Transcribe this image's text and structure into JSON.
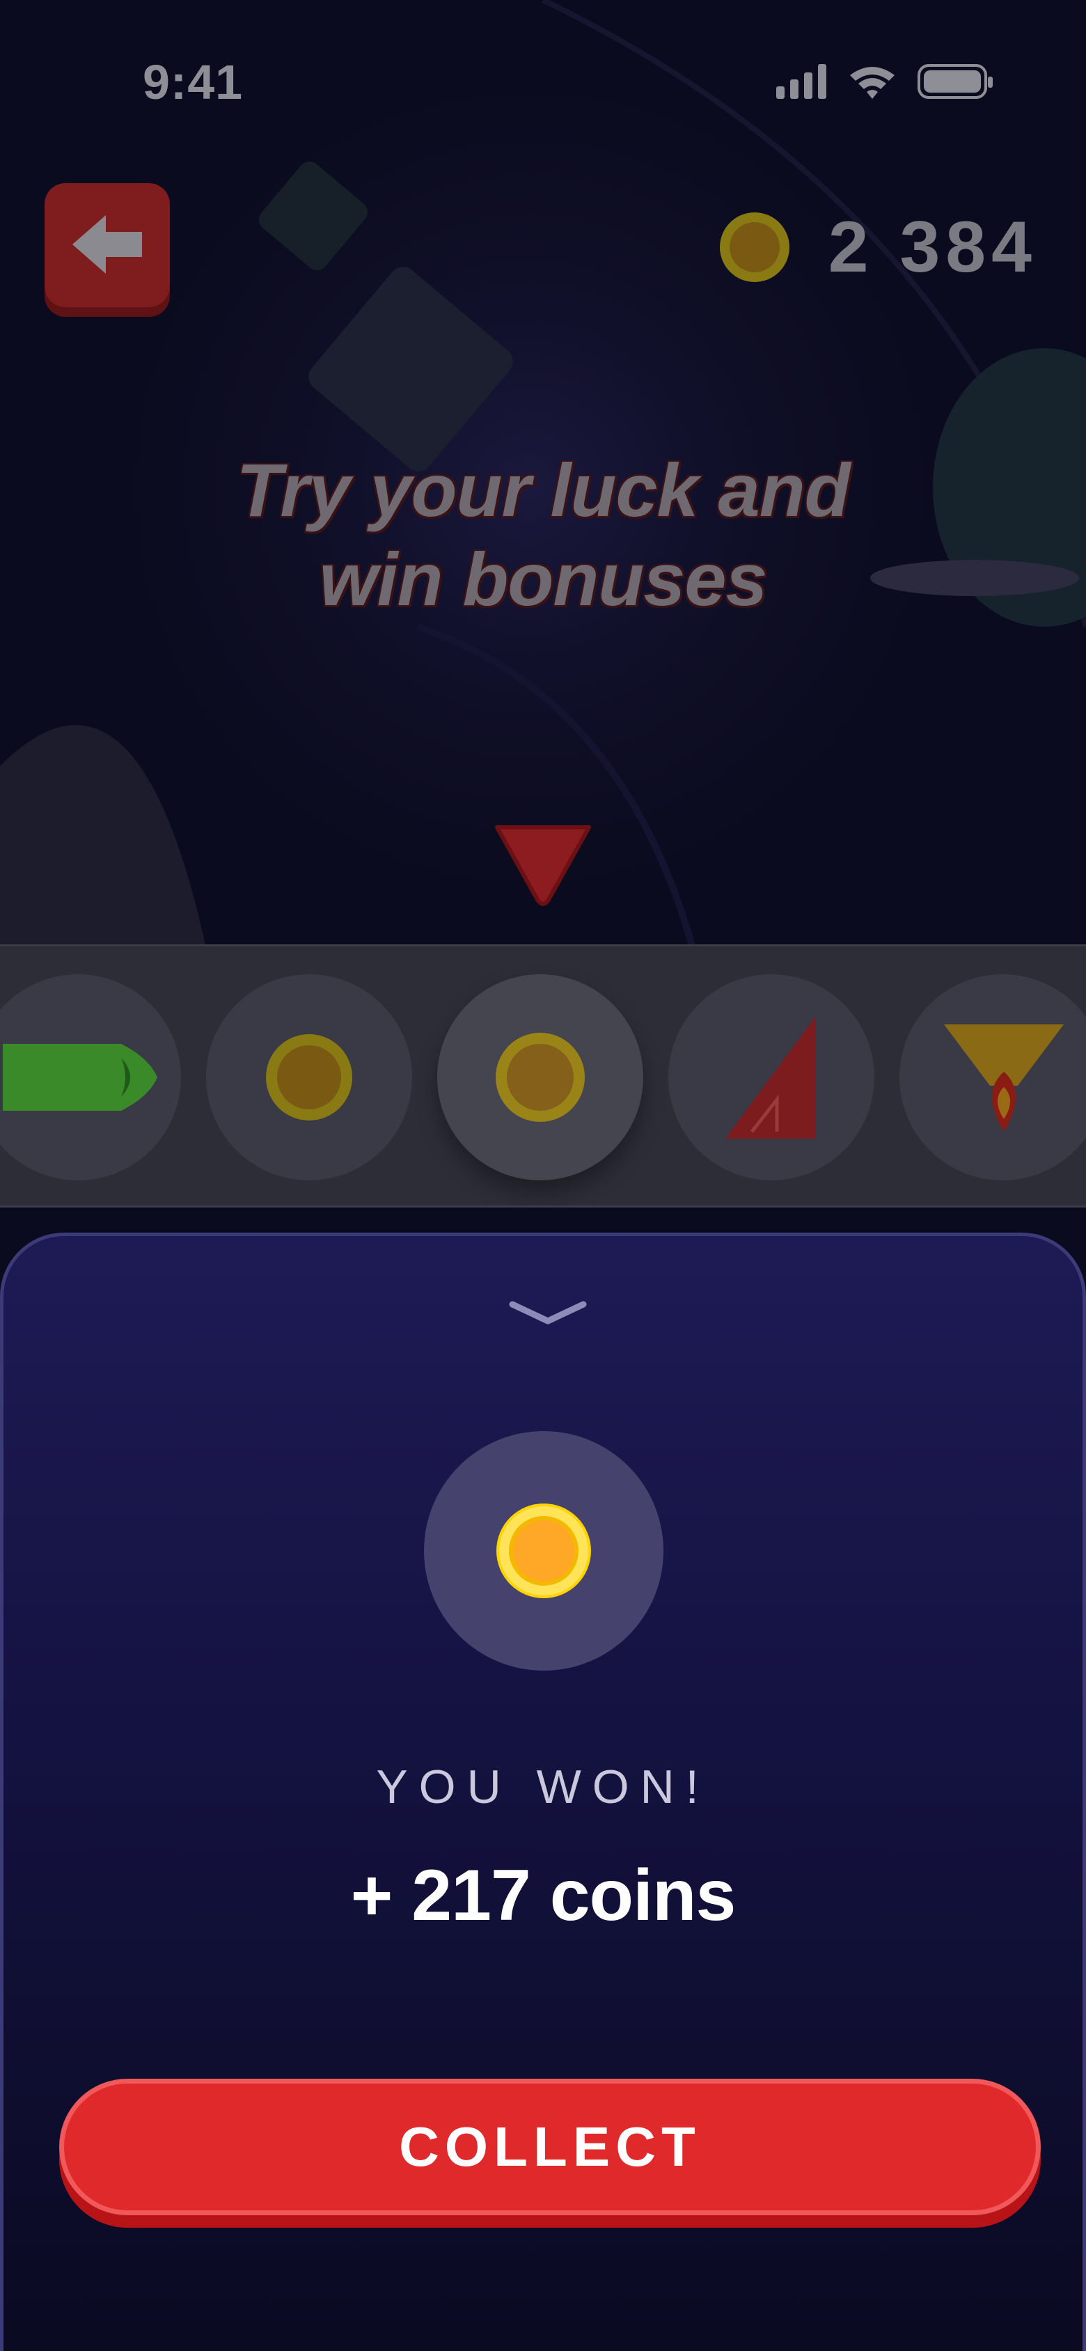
{
  "status_bar": {
    "time": "9:41",
    "icons": [
      "signal-icon",
      "wifi-icon",
      "battery-icon"
    ]
  },
  "header": {
    "back_icon": "arrow-left-icon",
    "coin_icon": "coin-icon",
    "coin_balance": "2 384"
  },
  "headline": {
    "line1": "Try your luck and",
    "line2": "win bonuses"
  },
  "reel": {
    "pointer_icon": "triangle-pointer-icon",
    "items": [
      {
        "icon": "green-rocket-icon"
      },
      {
        "icon": "coin-icon"
      },
      {
        "icon": "coin-icon",
        "selected": true
      },
      {
        "icon": "red-sail-icon"
      },
      {
        "icon": "flame-cone-icon"
      }
    ]
  },
  "result_sheet": {
    "collapse_icon": "chevron-down-icon",
    "prize_icon": "coin-icon",
    "label": "YOU WON!",
    "amount": "+ 217 coins",
    "button_label": "COLLECT"
  },
  "colors": {
    "accent_red": "#e0292b",
    "coin_gold": "#f5b800",
    "sheet_top": "#1e1a55",
    "sheet_bottom": "#0a0a22"
  }
}
